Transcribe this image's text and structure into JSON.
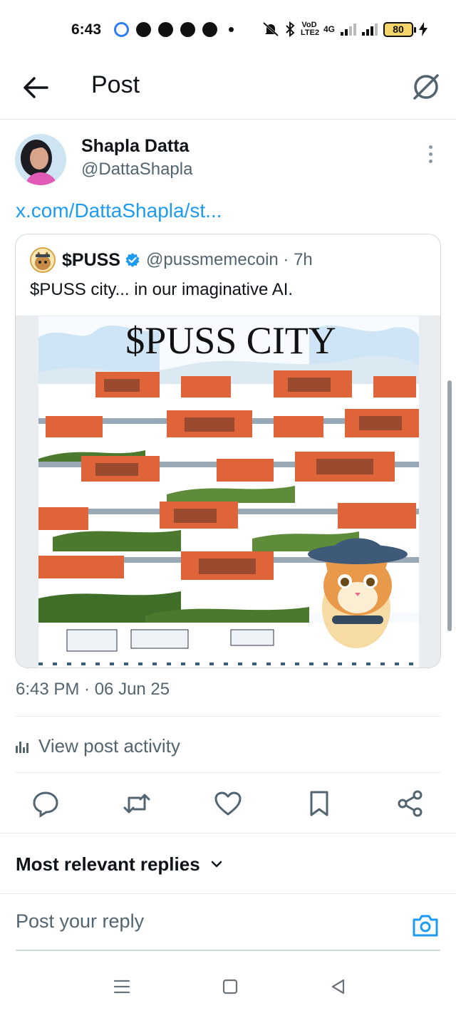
{
  "status_bar": {
    "time": "6:43",
    "network_badge": "VoD LTE2",
    "network_type": "4G",
    "battery_level": "80",
    "icons": [
      "messenger-lite-icon",
      "facebook-icon",
      "chat-bubble-icon",
      "snapchat-icon",
      "discord-icon",
      "notifications-muted-icon",
      "bluetooth-icon",
      "signal-icon",
      "battery-icon",
      "charging-icon"
    ]
  },
  "header": {
    "title": "Post",
    "back_icon": "arrow-left-icon",
    "grok_icon": "grok-icon"
  },
  "post": {
    "author_name": "Shapla Datta",
    "author_handle": "@DattaShapla",
    "link_text": "x.com/DattaShapla/st...",
    "timestamp": "6:43 PM · 06 Jun 25",
    "activity_label": "View post activity"
  },
  "quoted": {
    "name": "$PUSS",
    "handle_time": "@pussmemecoin · 7h",
    "text": "$PUSS city... in our imaginative AI.",
    "image_title": "$PUSS CITY"
  },
  "actions": [
    "reply-icon",
    "repost-icon",
    "like-icon",
    "bookmark-icon",
    "share-icon"
  ],
  "replies": {
    "sort_label": "Most relevant replies",
    "placeholder": "Post your reply"
  },
  "colors": {
    "accent": "#1d9bf0",
    "text": "#0f1419",
    "secondary_text": "#536471",
    "divider": "#e7e9ea"
  }
}
